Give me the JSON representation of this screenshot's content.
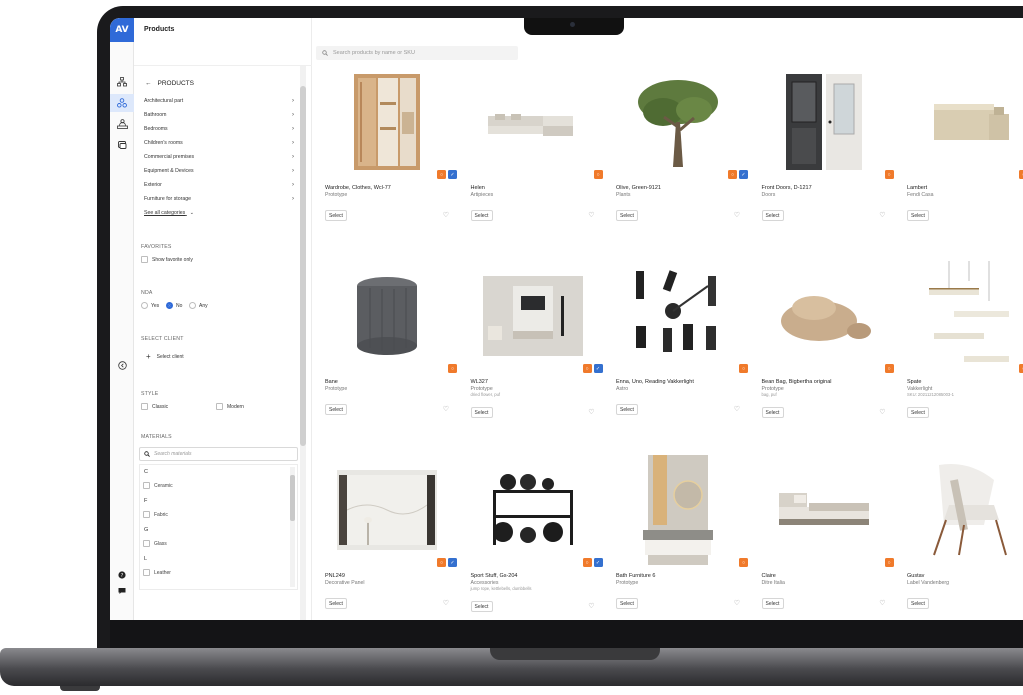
{
  "app": {
    "logo": "AV",
    "title": "Products"
  },
  "rail": {
    "icons": [
      "hierarchy-icon",
      "products-icon",
      "clients-icon",
      "gallery-icon"
    ],
    "collapse_icon": "collapse-icon",
    "bottom_icons": [
      "help-icon",
      "chat-icon"
    ]
  },
  "filters": {
    "back_label": "PRODUCTS",
    "categories": [
      {
        "label": "Architectural part"
      },
      {
        "label": "Bathroom"
      },
      {
        "label": "Bedrooms"
      },
      {
        "label": "Children's rooms"
      },
      {
        "label": "Commercial premises"
      },
      {
        "label": "Equipment & Devices"
      },
      {
        "label": "Exterior"
      },
      {
        "label": "Furniture for storage"
      }
    ],
    "see_all": "See all categories",
    "favorites": {
      "heading": "FAVORITES",
      "checkbox": "Show favorite only"
    },
    "nda": {
      "heading": "NDA",
      "options": [
        "Yes",
        "No",
        "Any"
      ],
      "selected": "No"
    },
    "client": {
      "heading": "SELECT CLIENT",
      "button": "Select client"
    },
    "style": {
      "heading": "STYLE",
      "options": [
        "Classic",
        "Modern"
      ]
    },
    "materials": {
      "heading": "MATERIALS",
      "placeholder": "Search materials",
      "groups": [
        {
          "letter": "C",
          "items": [
            "Ceramic"
          ]
        },
        {
          "letter": "F",
          "items": [
            "Fabric"
          ]
        },
        {
          "letter": "G",
          "items": [
            "Glass"
          ]
        },
        {
          "letter": "L",
          "items": [
            "Leather"
          ]
        }
      ]
    }
  },
  "search": {
    "placeholder": "Search products by name or SKU"
  },
  "select_label": "Select",
  "products": [
    {
      "name": "Wardrobe, Clothes, Wcl-77",
      "sub": "Prototype",
      "extra": "",
      "badges": [
        "orange",
        "blue"
      ],
      "icon": "wardrobe"
    },
    {
      "name": "Helen",
      "sub": "Artipieces",
      "extra": "",
      "badges": [
        "orange"
      ],
      "icon": "sofa"
    },
    {
      "name": "Olive, Green-9121",
      "sub": "Plants",
      "extra": "",
      "badges": [
        "orange",
        "blue"
      ],
      "icon": "tree"
    },
    {
      "name": "Front Doors, D-1217",
      "sub": "Doors",
      "extra": "",
      "badges": [
        "orange"
      ],
      "icon": "door"
    },
    {
      "name": "Lambert",
      "sub": "Fendi Casa",
      "extra": "",
      "badges": [
        "orange",
        "blue"
      ],
      "icon": "sideboard"
    },
    {
      "name": "Bane",
      "sub": "Prototype",
      "extra": "",
      "badges": [
        "orange"
      ],
      "icon": "pouf"
    },
    {
      "name": "WL327",
      "sub": "Prototype",
      "extra": "dried flower, puf",
      "badges": [
        "orange",
        "blue"
      ],
      "icon": "livingroom"
    },
    {
      "name": "Enna, Uno, Reading Vakkerlight",
      "sub": "Astro",
      "extra": "",
      "badges": [
        "orange"
      ],
      "icon": "lamps"
    },
    {
      "name": "Bean Bag, Bigbertha original",
      "sub": "Prototype",
      "extra": "bag, puf",
      "badges": [
        "orange"
      ],
      "icon": "beanbag"
    },
    {
      "name": "Spate",
      "sub": "Vakkerlight",
      "extra": "SKU: 20211212085003-1",
      "badges": [
        "orange",
        "blue"
      ],
      "icon": "pendant"
    },
    {
      "name": "PNL249",
      "sub": "Decorative Panel",
      "extra": "",
      "badges": [
        "orange",
        "blue"
      ],
      "icon": "panel"
    },
    {
      "name": "Sport Stuff, Gs-204",
      "sub": "Accessories",
      "extra": "jump rope, kettlebells, dumbbells",
      "badges": [
        "orange",
        "blue"
      ],
      "icon": "gym"
    },
    {
      "name": "Bath Furniture 6",
      "sub": "Prototype",
      "extra": "",
      "badges": [
        "orange"
      ],
      "icon": "bath"
    },
    {
      "name": "Claire",
      "sub": "Ditre Italia",
      "extra": "",
      "badges": [
        "orange"
      ],
      "icon": "bed"
    },
    {
      "name": "Gustav",
      "sub": "Label Vandenberg",
      "extra": "",
      "badges": [
        "blue"
      ],
      "icon": "chair"
    }
  ],
  "colors": {
    "accent": "#2f6ad8",
    "badge_orange": "#f07a2b",
    "badge_blue": "#3470cf"
  }
}
